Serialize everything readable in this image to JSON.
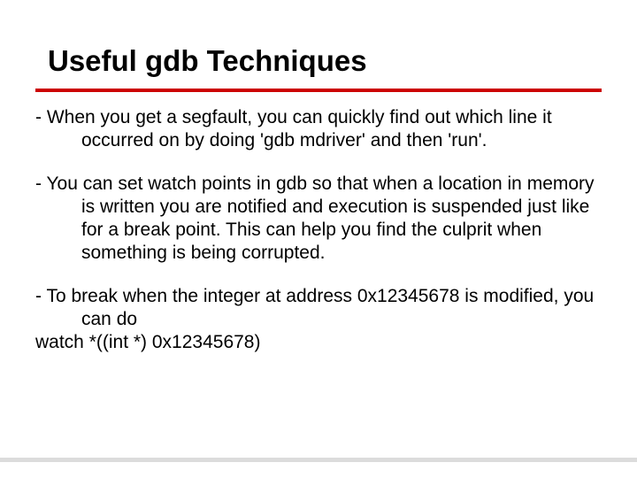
{
  "title": "Useful gdb Techniques",
  "items": [
    "- When you get a segfault, you can quickly find out which line it occurred on by doing 'gdb mdriver' and then 'run'.",
    "- You can set watch points in gdb so that when a location in memory is written you are notified and execution is suspended just like for a break point. This can help you find the culprit when something is being corrupted.",
    "- To break when the integer at address 0x12345678 is modified, you can do"
  ],
  "code_line": "watch *((int *) 0x12345678)"
}
